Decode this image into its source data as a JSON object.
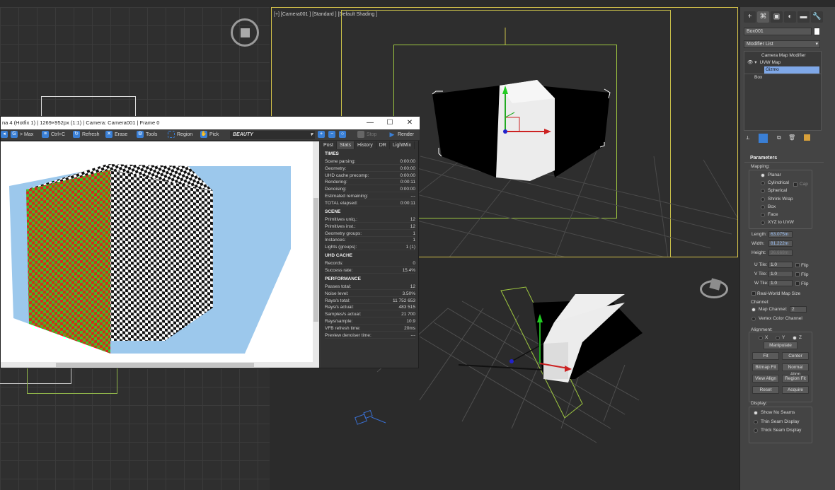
{
  "viewport_top_right": {
    "label": "[+] [Camera001 ] [Standard ] [Default Shading ]"
  },
  "vfb": {
    "title": "na 4 (Hotfix 1) | 1269×952px (1:1) | Camera: Camera001 | Frame 0",
    "window_buttons": [
      "—",
      "☐",
      "✕"
    ],
    "toolbar": {
      "max": "> Max",
      "ctrlc": "Ctrl+C",
      "refresh": "Refresh",
      "erase": "Erase",
      "tools": "Tools",
      "region": "Region",
      "pick": "Pick",
      "channel": "BEAUTY",
      "stop": "Stop",
      "render": "Render"
    },
    "stat_tabs": [
      "Post",
      "Stats",
      "History",
      "DR",
      "LightMix"
    ],
    "active_stat_tab": "Stats",
    "times": {
      "header": "TIMES",
      "rows": [
        {
          "k": "Scene parsing:",
          "v": "0:00:00"
        },
        {
          "k": "Geometry:",
          "v": "0:00:00"
        },
        {
          "k": "UHD cache precomp:",
          "v": "0:00:00"
        },
        {
          "k": "Rendering:",
          "v": "0:00:11"
        },
        {
          "k": "Denoising:",
          "v": "0:00:00"
        },
        {
          "k": "Estimated remaining:",
          "v": "---"
        },
        {
          "k": "TOTAL elapsed:",
          "v": "0:00:11"
        }
      ]
    },
    "scene": {
      "header": "SCENE",
      "rows": [
        {
          "k": "Primitives uniq.:",
          "v": "12"
        },
        {
          "k": "Primitives inst.:",
          "v": "12"
        },
        {
          "k": "Geometry groups:",
          "v": "1"
        },
        {
          "k": "Instances:",
          "v": "1"
        },
        {
          "k": "Lights (groups):",
          "v": "1 (1)"
        }
      ]
    },
    "uhd": {
      "header": "UHD CACHE",
      "rows": [
        {
          "k": "Records:",
          "v": "0"
        },
        {
          "k": "Success rate:",
          "v": "15.4%"
        }
      ]
    },
    "performance": {
      "header": "PERFORMANCE",
      "rows": [
        {
          "k": "Passes total:",
          "v": "12"
        },
        {
          "k": "Noise level:",
          "v": "3.50%"
        },
        {
          "k": "Rays/s total:",
          "v": "11 752 653"
        },
        {
          "k": "Rays/s actual:",
          "v": "483 515"
        },
        {
          "k": "Samples/s actual:",
          "v": "21 700"
        },
        {
          "k": "Rays/sample:",
          "v": "10.9"
        },
        {
          "k": "VFB refresh time:",
          "v": "20ms"
        },
        {
          "k": "Preview denoiser time:",
          "v": "---"
        }
      ]
    }
  },
  "command_panel": {
    "tabs": [
      "+",
      "⌘",
      "▣",
      "◐",
      "▬",
      "🔧"
    ],
    "object_name": "Box001",
    "modifier_list": "Modifier List",
    "stack": [
      {
        "label": "Camera Map Modifier",
        "indent": 0,
        "selected": false
      },
      {
        "label": "UVW Map",
        "indent": 0,
        "selected": false
      },
      {
        "label": "Gizmo",
        "indent": 1,
        "selected": true
      },
      {
        "label": "Box",
        "indent": -1,
        "selected": false
      }
    ],
    "parameters": {
      "title": "Parameters",
      "mapping_label": "Mapping:",
      "mapping_options": [
        {
          "label": "Planar",
          "on": true
        },
        {
          "label": "Cylindrical",
          "on": false
        },
        {
          "label": "Spherical",
          "on": false
        },
        {
          "label": "Shrink Wrap",
          "on": false
        },
        {
          "label": "Box",
          "on": false
        },
        {
          "label": "Face",
          "on": false
        },
        {
          "label": "XYZ to UVW",
          "on": false
        }
      ],
      "cap_label": "Cap",
      "length_label": "Length:",
      "length": "63.075m",
      "width_label": "Width:",
      "width": "81.222m",
      "height_label": "Height:",
      "height": "36.668m",
      "utile_label": "U Tile:",
      "utile": "1.0",
      "vtile_label": "V Tile:",
      "vtile": "1.0",
      "wtile_label": "W Tile:",
      "wtile": "1.0",
      "flip_label": "Flip",
      "real_world": "Real-World Map Size",
      "channel_label": "Channel:",
      "map_channel": "Map Channel:",
      "map_channel_val": "2",
      "vertex_color": "Vertex Color Channel",
      "alignment_label": "Alignment:",
      "axes": [
        {
          "label": "X",
          "on": false
        },
        {
          "label": "Y",
          "on": false
        },
        {
          "label": "Z",
          "on": true
        }
      ],
      "buttons": {
        "manipulate": "Manipulate",
        "fit": "Fit",
        "center": "Center",
        "bitmap_fit": "Bitmap Fit",
        "normal_align": "Normal Align",
        "view_align": "View Align",
        "region_fit": "Region Fit",
        "reset": "Reset",
        "acquire": "Acquire"
      },
      "display_label": "Display:",
      "display_options": [
        {
          "label": "Show No Seams",
          "on": true
        },
        {
          "label": "Thin Seam Display",
          "on": false
        },
        {
          "label": "Thick Seam Display",
          "on": false
        }
      ]
    }
  }
}
